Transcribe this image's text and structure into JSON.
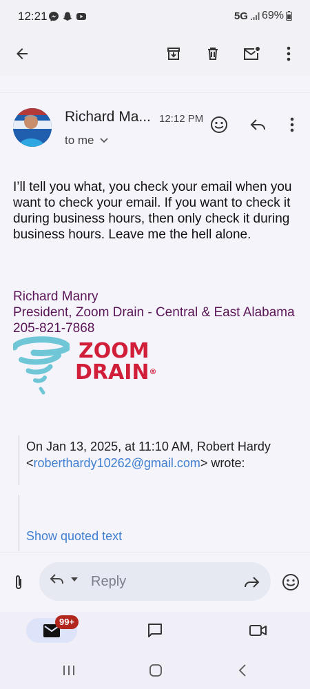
{
  "status_bar": {
    "time": "12:21",
    "network": "5G",
    "battery": "69%",
    "notification_icons": [
      "messenger-icon",
      "snapchat-icon",
      "youtube-icon"
    ]
  },
  "toolbar": {
    "icons": [
      "back-arrow-icon",
      "archive-icon",
      "delete-icon",
      "mark-unread-icon",
      "more-vert-icon"
    ]
  },
  "email": {
    "sender": "Richard Ma...",
    "time": "12:12 PM",
    "recipient": "to me",
    "body": "I’ll tell you what, you check your email when you want to check your email. If you want to check it during business hours, then only check it during business hours. Leave me the hell alone.",
    "signature": {
      "name": "Richard Manry",
      "title": "President, Zoom Drain - Central & East Alabama",
      "phone": "205-821-7868"
    },
    "logo": {
      "line1": "ZOOM",
      "line2": "DRAIN",
      "mark": "®",
      "colors": {
        "red": "#d11f3a",
        "teal": "#6ec6d6"
      }
    },
    "quoted": {
      "prefix": "On Jan 13, 2025, at 11:10 AM, Robert Hardy",
      "lt": "<",
      "email": "roberthardy10262@gmail.com",
      "suffix": "> wrote:",
      "show_label": "Show quoted text"
    }
  },
  "reply_bar": {
    "placeholder": "Reply"
  },
  "bottom_nav": {
    "badge": "99+",
    "items": [
      "mail",
      "chat",
      "meet"
    ]
  },
  "colors": {
    "accent_blue": "#3f7fd0",
    "signature_purple": "#5a1557",
    "badge_red": "#b3261e"
  }
}
